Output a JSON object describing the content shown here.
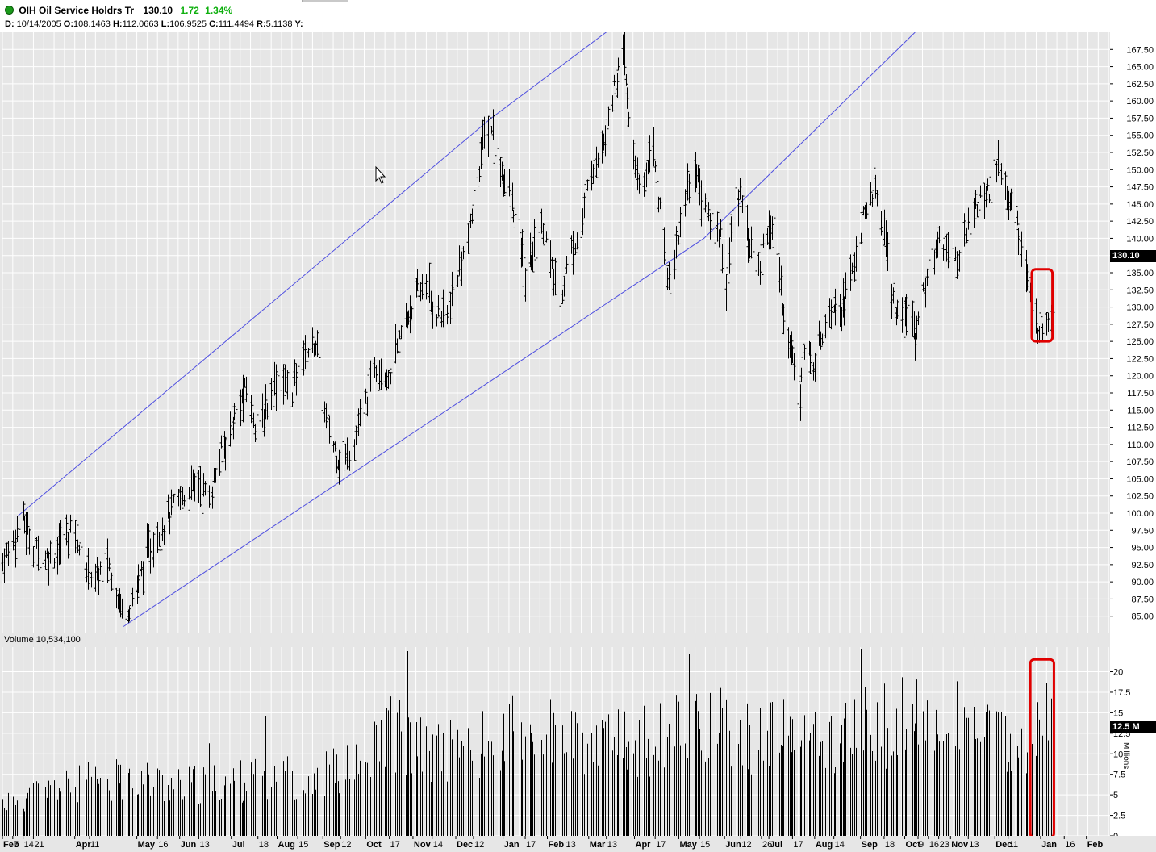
{
  "header": {
    "symbol_line": "OIH Oil Service Holdrs Tr",
    "last": "130.10",
    "change": "1.72",
    "change_pct": "1.34%",
    "ohlc": {
      "date_label": "D:",
      "date": "10/14/2005",
      "open_label": "O:",
      "open": "108.1463",
      "high_label": "H:",
      "high": "112.0663",
      "low_label": "L:",
      "low": "106.9525",
      "close_label": "C:",
      "close": "111.4494",
      "range_label": "R:",
      "range": "5.1138",
      "y_label": "Y:"
    }
  },
  "volume_panel": {
    "label": "Volume 10,534,100",
    "last_badge": "12.5 M",
    "units_label": "Millions"
  },
  "price_badge": "130.10",
  "colors": {
    "bars": "#000000",
    "channel": "#5050e0",
    "highlight": "#e00000",
    "grid": "#ffffff",
    "panel_bg": "#e6e6e6",
    "up_change": "#0fb00f"
  },
  "chart_data": [
    {
      "type": "ohlc-bar",
      "title": "OIH Oil Service Holdrs Tr",
      "period": "daily",
      "ylim": [
        82.5,
        170
      ],
      "y_ticks": [
        85,
        87.5,
        90,
        92.5,
        95,
        97.5,
        100,
        102.5,
        105,
        107.5,
        110,
        112.5,
        115,
        117.5,
        120,
        122.5,
        125,
        127.5,
        130,
        132.5,
        135,
        137.5,
        140,
        142.5,
        145,
        147.5,
        150,
        152.5,
        155,
        157.5,
        160,
        162.5,
        165,
        167.5
      ],
      "y_tick_labels": [
        "85.00",
        "87.50",
        "90.00",
        "92.50",
        "95.00",
        "97.50",
        "100.00",
        "102.50",
        "105.00",
        "107.50",
        "110.00",
        "112.50",
        "115.00",
        "117.50",
        "120.00",
        "122.50",
        "125.00",
        "127.50",
        "130.00",
        "132.50",
        "135.00",
        "137.50",
        "140.00",
        "142.50",
        "145.00",
        "147.50",
        "150.00",
        "152.50",
        "155.00",
        "157.50",
        "160.00",
        "162.50",
        "165.00",
        "167.50"
      ],
      "x_range_days": [
        0,
        750
      ],
      "x_tick_labels": [
        {
          "label": "Feb",
          "day": 0
        },
        {
          "label": "7",
          "day": 7
        },
        {
          "label": "14",
          "day": 14
        },
        {
          "label": "21",
          "day": 21
        },
        {
          "label": "Apr",
          "day": 49
        },
        {
          "label": "11",
          "day": 59
        },
        {
          "label": "May",
          "day": 91
        },
        {
          "label": "16",
          "day": 105
        },
        {
          "label": "Jun",
          "day": 120
        },
        {
          "label": "13",
          "day": 133
        },
        {
          "label": "Jul",
          "day": 155
        },
        {
          "label": "18",
          "day": 173
        },
        {
          "label": "Aug",
          "day": 186
        },
        {
          "label": "15",
          "day": 200
        },
        {
          "label": "Sep",
          "day": 217
        },
        {
          "label": "12",
          "day": 229
        },
        {
          "label": "Oct",
          "day": 246
        },
        {
          "label": "17",
          "day": 262
        },
        {
          "label": "Nov",
          "day": 278
        },
        {
          "label": "14",
          "day": 291
        },
        {
          "label": "Dec",
          "day": 307
        },
        {
          "label": "12",
          "day": 319
        },
        {
          "label": "Jan",
          "day": 339
        },
        {
          "label": "17",
          "day": 354
        },
        {
          "label": "Feb",
          "day": 369
        },
        {
          "label": "13",
          "day": 381
        },
        {
          "label": "Mar",
          "day": 397
        },
        {
          "label": "13",
          "day": 409
        },
        {
          "label": "Apr",
          "day": 428
        },
        {
          "label": "17",
          "day": 442
        },
        {
          "label": "May",
          "day": 458
        },
        {
          "label": "15",
          "day": 472
        },
        {
          "label": "Jun",
          "day": 489
        },
        {
          "label": "12",
          "day": 500
        },
        {
          "label": "26",
          "day": 514
        },
        {
          "label": "Jul",
          "day": 519
        },
        {
          "label": "17",
          "day": 535
        },
        {
          "label": "Aug",
          "day": 550
        },
        {
          "label": "14",
          "day": 563
        },
        {
          "label": "Sep",
          "day": 581
        },
        {
          "label": "18",
          "day": 597
        },
        {
          "label": "Oct",
          "day": 611
        },
        {
          "label": "9",
          "day": 620
        },
        {
          "label": "16",
          "day": 627
        },
        {
          "label": "23",
          "day": 634
        },
        {
          "label": "Nov",
          "day": 642
        },
        {
          "label": "13",
          "day": 654
        },
        {
          "label": "Dec",
          "day": 672
        },
        {
          "label": "11",
          "day": 681
        },
        {
          "label": "Jan",
          "day": 703
        },
        {
          "label": "16",
          "day": 719
        },
        {
          "label": "Feb",
          "day": 734
        }
      ],
      "trend_channel": [
        {
          "name": "upper",
          "points": [
            [
              10,
              99.5
            ],
            [
              331,
              157.5
            ],
            [
              415,
              171
            ]
          ]
        },
        {
          "name": "lower",
          "points": [
            [
              82,
              83.5
            ],
            [
              475,
              140
            ],
            [
              618,
              170
            ]
          ]
        }
      ],
      "price_path": [
        {
          "day": 0,
          "close": 93
        },
        {
          "day": 7,
          "close": 96
        },
        {
          "day": 14,
          "close": 99
        },
        {
          "day": 21,
          "close": 95
        },
        {
          "day": 28,
          "close": 93.5
        },
        {
          "day": 35,
          "close": 94
        },
        {
          "day": 42,
          "close": 96.5
        },
        {
          "day": 49,
          "close": 98
        },
        {
          "day": 56,
          "close": 92
        },
        {
          "day": 63,
          "close": 90
        },
        {
          "day": 70,
          "close": 94
        },
        {
          "day": 77,
          "close": 89
        },
        {
          "day": 82,
          "close": 85
        },
        {
          "day": 89,
          "close": 88
        },
        {
          "day": 96,
          "close": 93
        },
        {
          "day": 105,
          "close": 97
        },
        {
          "day": 112,
          "close": 99.5
        },
        {
          "day": 120,
          "close": 102
        },
        {
          "day": 133,
          "close": 104.5
        },
        {
          "day": 140,
          "close": 102
        },
        {
          "day": 147,
          "close": 108
        },
        {
          "day": 155,
          "close": 113
        },
        {
          "day": 165,
          "close": 118
        },
        {
          "day": 173,
          "close": 112
        },
        {
          "day": 186,
          "close": 120
        },
        {
          "day": 196,
          "close": 118
        },
        {
          "day": 205,
          "close": 123
        },
        {
          "day": 212,
          "close": 125
        },
        {
          "day": 217,
          "close": 115
        },
        {
          "day": 224,
          "close": 110
        },
        {
          "day": 229,
          "close": 107
        },
        {
          "day": 236,
          "close": 109
        },
        {
          "day": 246,
          "close": 116
        },
        {
          "day": 252,
          "close": 122
        },
        {
          "day": 262,
          "close": 120
        },
        {
          "day": 270,
          "close": 126
        },
        {
          "day": 278,
          "close": 131
        },
        {
          "day": 287,
          "close": 134
        },
        {
          "day": 291,
          "close": 130
        },
        {
          "day": 300,
          "close": 128
        },
        {
          "day": 307,
          "close": 134
        },
        {
          "day": 315,
          "close": 140
        },
        {
          "day": 320,
          "close": 146
        },
        {
          "day": 326,
          "close": 155
        },
        {
          "day": 331,
          "close": 156.5
        },
        {
          "day": 335,
          "close": 152
        },
        {
          "day": 342,
          "close": 147
        },
        {
          "day": 349,
          "close": 142
        },
        {
          "day": 354,
          "close": 134
        },
        {
          "day": 360,
          "close": 139
        },
        {
          "day": 366,
          "close": 142
        },
        {
          "day": 372,
          "close": 135
        },
        {
          "day": 378,
          "close": 131.5
        },
        {
          "day": 384,
          "close": 138
        },
        {
          "day": 392,
          "close": 141
        },
        {
          "day": 398,
          "close": 150
        },
        {
          "day": 405,
          "close": 153
        },
        {
          "day": 412,
          "close": 160
        },
        {
          "day": 418,
          "close": 165
        },
        {
          "day": 421,
          "close": 166
        },
        {
          "day": 424,
          "close": 157
        },
        {
          "day": 428,
          "close": 151
        },
        {
          "day": 432,
          "close": 145
        },
        {
          "day": 436,
          "close": 150
        },
        {
          "day": 440,
          "close": 155
        },
        {
          "day": 444,
          "close": 146
        },
        {
          "day": 448,
          "close": 138
        },
        {
          "day": 452,
          "close": 133
        },
        {
          "day": 456,
          "close": 139
        },
        {
          "day": 462,
          "close": 145
        },
        {
          "day": 468,
          "close": 151
        },
        {
          "day": 474,
          "close": 146
        },
        {
          "day": 480,
          "close": 142
        },
        {
          "day": 486,
          "close": 141
        },
        {
          "day": 490,
          "close": 132
        },
        {
          "day": 494,
          "close": 143
        },
        {
          "day": 500,
          "close": 147
        },
        {
          "day": 506,
          "close": 139
        },
        {
          "day": 512,
          "close": 135
        },
        {
          "day": 518,
          "close": 142
        },
        {
          "day": 524,
          "close": 139
        },
        {
          "day": 530,
          "close": 127
        },
        {
          "day": 536,
          "close": 122
        },
        {
          "day": 540,
          "close": 118
        },
        {
          "day": 544,
          "close": 125
        },
        {
          "day": 548,
          "close": 121
        },
        {
          "day": 552,
          "close": 124
        },
        {
          "day": 557,
          "close": 128
        },
        {
          "day": 562,
          "close": 131
        },
        {
          "day": 568,
          "close": 130
        },
        {
          "day": 574,
          "close": 134
        },
        {
          "day": 580,
          "close": 140
        },
        {
          "day": 586,
          "close": 145
        },
        {
          "day": 590,
          "close": 147.5
        },
        {
          "day": 594,
          "close": 144
        },
        {
          "day": 598,
          "close": 140
        },
        {
          "day": 602,
          "close": 132
        },
        {
          "day": 606,
          "close": 129
        },
        {
          "day": 610,
          "close": 127
        },
        {
          "day": 614,
          "close": 130
        },
        {
          "day": 618,
          "close": 126
        },
        {
          "day": 622,
          "close": 131
        },
        {
          "day": 628,
          "close": 136
        },
        {
          "day": 634,
          "close": 140
        },
        {
          "day": 640,
          "close": 139
        },
        {
          "day": 646,
          "close": 136
        },
        {
          "day": 652,
          "close": 141
        },
        {
          "day": 658,
          "close": 144
        },
        {
          "day": 664,
          "close": 146
        },
        {
          "day": 670,
          "close": 148
        },
        {
          "day": 675,
          "close": 150
        },
        {
          "day": 680,
          "close": 147
        },
        {
          "day": 686,
          "close": 143
        },
        {
          "day": 690,
          "close": 139
        },
        {
          "day": 694,
          "close": 134
        },
        {
          "day": 698,
          "close": 128
        },
        {
          "day": 703,
          "close": 127
        },
        {
          "day": 708,
          "close": 129
        },
        {
          "day": 712,
          "close": 130.1
        }
      ],
      "highlight_box": {
        "day_from": 697,
        "day_to": 711,
        "price_from": 125,
        "price_to": 135.5
      }
    },
    {
      "type": "bar",
      "title": "Volume 10,534,100",
      "units": "Millions",
      "ylim": [
        0,
        23
      ],
      "y_ticks": [
        0,
        2.5,
        5,
        7.5,
        10,
        12.5,
        15,
        17.5,
        20
      ],
      "y_tick_labels": [
        "0",
        "2.5",
        "5",
        "7.5",
        "10",
        "12.5",
        "15",
        "17.5",
        "20"
      ],
      "volume_path": [
        {
          "day": 0,
          "volume": 4
        },
        {
          "day": 30,
          "volume": 5.5
        },
        {
          "day": 60,
          "volume": 6.5
        },
        {
          "day": 90,
          "volume": 7
        },
        {
          "day": 120,
          "volume": 6
        },
        {
          "day": 150,
          "volume": 6.5
        },
        {
          "day": 180,
          "volume": 7
        },
        {
          "day": 215,
          "volume": 7.5
        },
        {
          "day": 246,
          "volume": 8.5
        },
        {
          "day": 262,
          "volume": 13
        },
        {
          "day": 290,
          "volume": 10
        },
        {
          "day": 320,
          "volume": 10.5
        },
        {
          "day": 350,
          "volume": 13
        },
        {
          "day": 380,
          "volume": 12
        },
        {
          "day": 410,
          "volume": 11
        },
        {
          "day": 440,
          "volume": 11.5
        },
        {
          "day": 470,
          "volume": 14
        },
        {
          "day": 500,
          "volume": 12
        },
        {
          "day": 530,
          "volume": 12
        },
        {
          "day": 560,
          "volume": 11
        },
        {
          "day": 590,
          "volume": 13.5
        },
        {
          "day": 620,
          "volume": 14
        },
        {
          "day": 650,
          "volume": 12.5
        },
        {
          "day": 675,
          "volume": 11
        },
        {
          "day": 695,
          "volume": 9
        },
        {
          "day": 705,
          "volume": 15
        },
        {
          "day": 712,
          "volume": 12.5
        }
      ],
      "highlight_box": {
        "day_from": 696,
        "day_to": 712,
        "volume_from": -0.2,
        "volume_to": 21.5
      }
    }
  ]
}
